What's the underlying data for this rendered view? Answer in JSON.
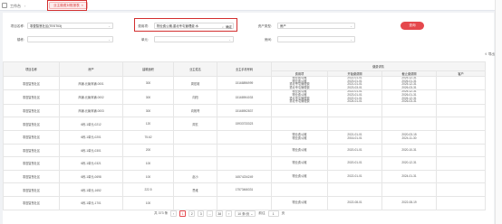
{
  "topbar": {
    "workspace": "工作台",
    "active_tab": "业主缴费对账报表"
  },
  "filters": {
    "project_label": "项目名称:",
    "project_value": "零壹智慧社区(TEST03)",
    "fee_label": "费用项:",
    "fee_value": "物业费公摊,重北专屯管理费.水",
    "fee_query": "确定",
    "asset_type_label": "资产类型:",
    "asset_type_value": "房产",
    "building_label": "楼栋:",
    "building_placeholder": "",
    "unit_label": "单元:",
    "unit_placeholder": "",
    "room_label": "房间:",
    "room_placeholder": "",
    "submit": "查询",
    "export": "导出"
  },
  "table": {
    "headers": {
      "project": "项目名称",
      "house": "房产",
      "area": "建筑面积",
      "owner": "业主姓名",
      "phone": "业主手机号码",
      "fee_detail": "缴费详情",
      "fee_item": "费用项",
      "start": "开始缴费期",
      "end": "截止缴费期",
      "customer": "客户"
    },
    "rows": [
      {
        "project": "零壹智慧社区",
        "house": "商铺-元聚商铺-0001",
        "area": "300",
        "owner": "周宏雄",
        "phone": "15168896999",
        "fees": [
          "物业费公摊",
          "物业费公摊",
          "重北专屯管理费",
          "重北专屯管理费"
        ],
        "starts": [
          "2022-01-01",
          "2023-01-01",
          "2021-01-01",
          "2023-03-01"
        ],
        "ends": [
          "2025-12-31",
          "2026-01-31",
          "2025-12-31",
          "2026-03-31"
        ]
      },
      {
        "project": "零壹智慧社区",
        "house": "商铺-元聚商铺-0002",
        "area": "300",
        "owner": "向阳",
        "phone": "15168904033",
        "fees": [
          "物业费公摊",
          "物业费公摊",
          "重北专屯管理费",
          "重北专屯管理费"
        ],
        "starts": [
          "2022-01-01",
          "2023-01-01",
          "2022-01-01",
          "2024-01-01"
        ],
        "ends": [
          "2025-12-31",
          "2026-01-31",
          "2026-12-31",
          "2026-03-31"
        ]
      },
      {
        "project": "零壹智慧社区",
        "house": "商铺-元聚商铺-0003",
        "area": "300",
        "owner": "向帆哥",
        "phone": "15168902837",
        "fees": [],
        "starts": [],
        "ends": []
      },
      {
        "project": "零壹智慧社区",
        "house": "6栋-1单元-0212",
        "area": "120",
        "owner": "周玄",
        "phone": "15933733323",
        "fees": [],
        "starts": [],
        "ends": []
      },
      {
        "project": "零壹智慧社区",
        "house": "6栋-1单元-0201",
        "area": "75.62",
        "owner": "",
        "phone": "",
        "fees": [
          "物业费公摊",
          "物业费公摊"
        ],
        "starts": [
          "2021-01-01",
          "2016-01-01"
        ],
        "ends": [
          "2020-03-15",
          "2024-11-30"
        ]
      },
      {
        "project": "零壹智慧社区",
        "house": "6栋-1单元-0301",
        "area": "200",
        "owner": "",
        "phone": "",
        "fees": [
          "物业费公摊"
        ],
        "starts": [
          "2020-01-01"
        ],
        "ends": [
          "2020-10-31"
        ]
      },
      {
        "project": "零壹智慧社区",
        "house": "6栋-1单元-0321",
        "area": "100",
        "owner": "",
        "phone": "",
        "fees": [
          "物业费公摊"
        ],
        "starts": [
          "2020-01-01"
        ],
        "ends": [
          "2020-12-31"
        ]
      },
      {
        "project": "零壹智慧社区",
        "house": "6栋-1单元-0698",
        "area": "100",
        "owner": "赵小",
        "phone": "16574234249",
        "fees": [
          "物业费公摊"
        ],
        "starts": [
          "2022-01-01"
        ],
        "ends": [
          "2024-01-31"
        ]
      },
      {
        "project": "零壹智慧社区",
        "house": "6栋-1单元-1652",
        "area": "222.5",
        "owner": "思维",
        "phone": "17573466331",
        "fees": [],
        "starts": [],
        "ends": []
      },
      {
        "project": "零壹智慧社区",
        "house": "6栋-1单元-1701",
        "area": "100",
        "owner": "",
        "phone": "",
        "fees": [
          "物业费公摊"
        ],
        "starts": [
          "2022-08-01"
        ],
        "ends": [
          "2022-08-19"
        ]
      }
    ]
  },
  "pager": {
    "total": "共 373 条",
    "pages": [
      "1",
      "2",
      "3",
      "...",
      "38"
    ],
    "prev": "‹",
    "next": "›",
    "page_size": "10 条/页",
    "goto_label": "前往",
    "goto_value": "1",
    "goto_suffix": "页"
  }
}
